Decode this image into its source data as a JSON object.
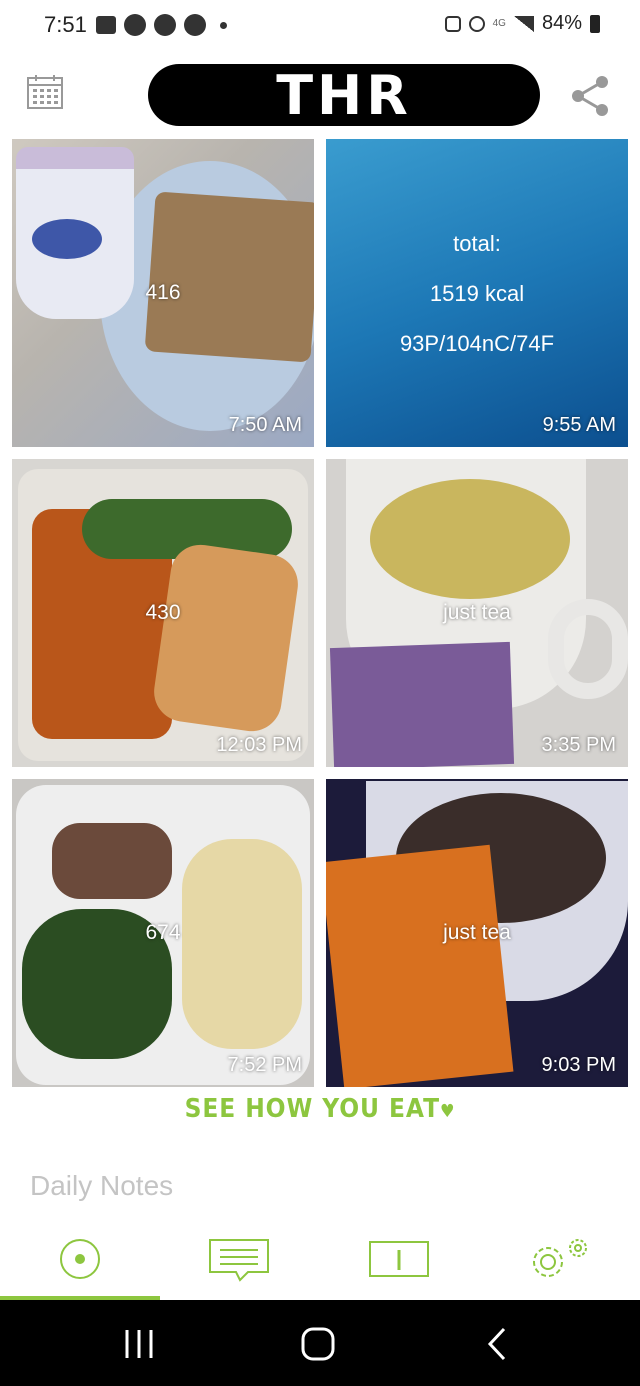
{
  "status_bar": {
    "time": "7:51",
    "network": "4G",
    "battery": "84%"
  },
  "header": {
    "title": "THR",
    "calendar_icon": "calendar-icon",
    "share_icon": "share-icon"
  },
  "entries": [
    {
      "kcal": "416",
      "time": "7:50 AM",
      "photo": "yogurt-toast"
    },
    {
      "type": "summary",
      "label": "total:",
      "kcal": "1519 kcal",
      "macros": "93P/104nC/74F",
      "time": "9:55 AM"
    },
    {
      "kcal": "430",
      "time": "12:03 PM",
      "photo": "salmon-sweet-potato"
    },
    {
      "kcal": "just tea",
      "time": "3:35 PM",
      "photo": "tea-cup"
    },
    {
      "kcal": "674",
      "time": "7:52 PM",
      "photo": "dinner-plate"
    },
    {
      "kcal": "just tea",
      "time": "9:03 PM",
      "photo": "bedtime-tea"
    }
  ],
  "tagline": "SEE HOW YOU EAT",
  "notes_placeholder": "Daily Notes",
  "tabs": [
    {
      "name": "home",
      "icon": "circle-dot-icon",
      "active": true
    },
    {
      "name": "notes",
      "icon": "message-icon"
    },
    {
      "name": "info",
      "icon": "info-icon"
    },
    {
      "name": "settings",
      "icon": "settings-gear-icon"
    }
  ],
  "accent_color": "#8dc63f"
}
